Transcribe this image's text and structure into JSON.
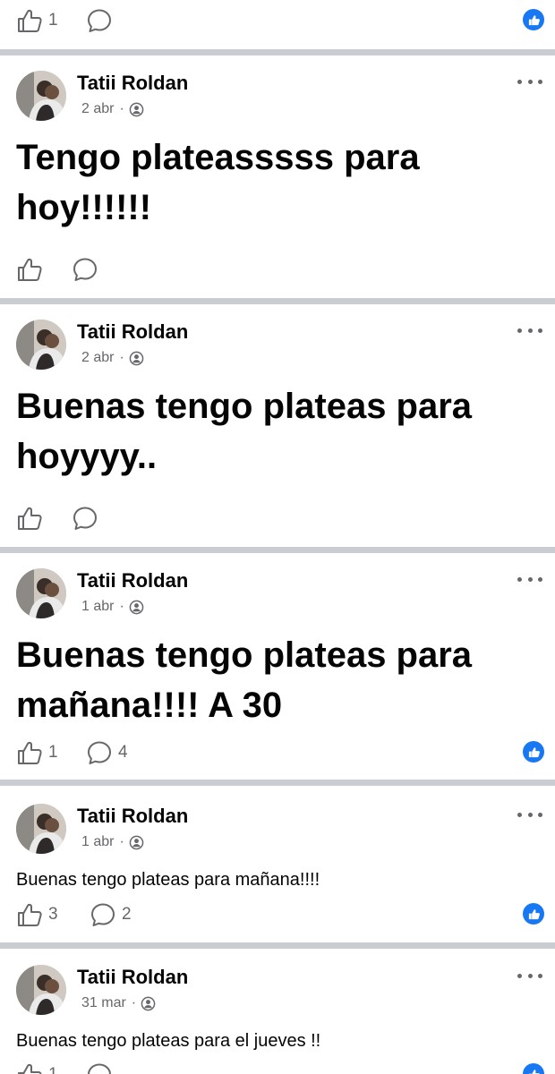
{
  "colors": {
    "accent": "#1877f2",
    "secondary_text": "#65676b",
    "separator": "#c9ccd1"
  },
  "top_bar": {
    "like_count": "1"
  },
  "posts": [
    {
      "author": "Tatii Roldan",
      "date": "2 abr",
      "dot": "·",
      "text": "Tengo plateasssss para hoy!!!!!!",
      "style": "big",
      "likes": "",
      "comments": ""
    },
    {
      "author": "Tatii Roldan",
      "date": "2 abr",
      "dot": "·",
      "text": "Buenas tengo plateas para hoyyyy..",
      "style": "big",
      "likes": "",
      "comments": ""
    },
    {
      "author": "Tatii Roldan",
      "date": "1 abr",
      "dot": "·",
      "text": "Buenas tengo plateas para mañana!!!! A 30",
      "style": "big",
      "likes": "1",
      "comments": "4"
    },
    {
      "author": "Tatii Roldan",
      "date": "1 abr",
      "dot": "·",
      "text": "Buenas tengo plateas para mañana!!!!",
      "style": "small",
      "likes": "3",
      "comments": "2"
    },
    {
      "author": "Tatii Roldan",
      "date": "31 mar",
      "dot": "·",
      "text": "Buenas tengo plateas para el jueves !!",
      "style": "small",
      "likes": "1",
      "comments": ""
    }
  ],
  "icons": {
    "like": "thumbs-up-icon",
    "comment": "comment-bubble-icon",
    "reaction": "like-reaction-icon",
    "privacy": "friends-privacy-icon",
    "more": "more-options-icon"
  }
}
